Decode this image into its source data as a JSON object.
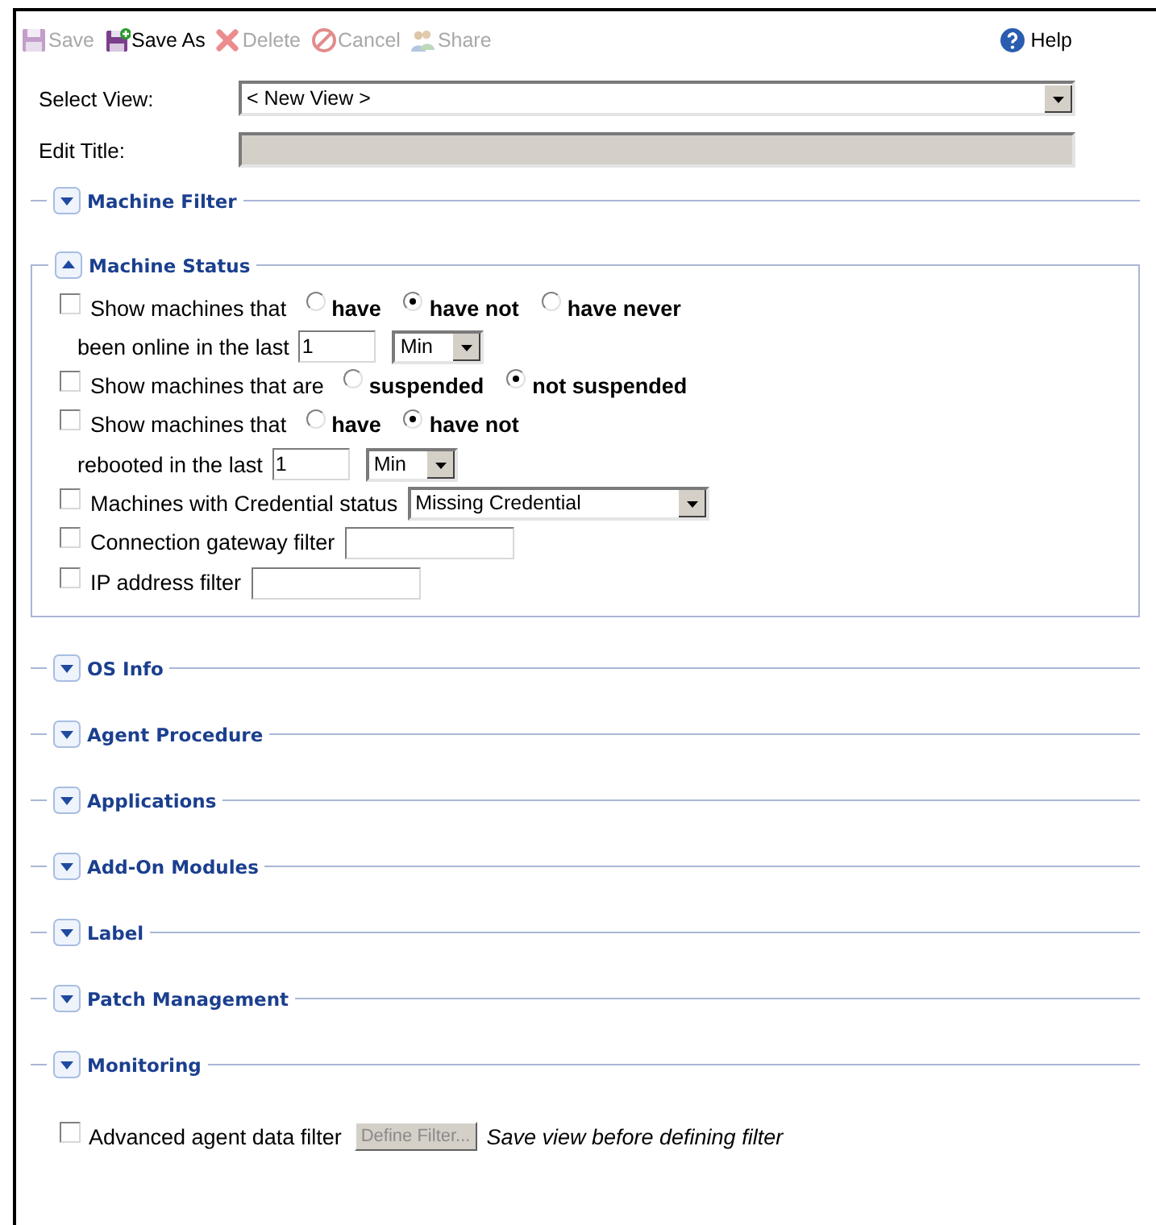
{
  "toolbar": [
    {
      "kind": "save",
      "label": "Save",
      "disabled": true
    },
    {
      "kind": "save_as",
      "label": "Save As",
      "disabled": false
    },
    {
      "kind": "delete",
      "label": "Delete",
      "disabled": true
    },
    {
      "kind": "cancel",
      "label": "Cancel",
      "disabled": true
    },
    {
      "kind": "share",
      "label": "Share",
      "disabled": true
    }
  ],
  "help": {
    "label": "Help"
  },
  "select_view": {
    "label": "Select View:",
    "value": "< New View >"
  },
  "edit_title": {
    "label": "Edit Title:",
    "disabled": true
  },
  "sections": [
    {
      "title": "Machine Filter",
      "expanded": false
    },
    {
      "title": "Machine Status",
      "expanded": true,
      "rows": [
        {
          "kind": "main",
          "items": [
            {
              "kind": "checkbox",
              "checked": false
            },
            {
              "kind": "text",
              "text": "Show machines that"
            },
            {
              "kind": "radio",
              "label": "have",
              "selected": false
            },
            {
              "kind": "radio",
              "label": "have not",
              "selected": true
            },
            {
              "kind": "radio",
              "label": "have never",
              "selected": false
            }
          ]
        },
        {
          "kind": "sub",
          "items": [
            {
              "kind": "text",
              "text": "been online in the last"
            },
            {
              "kind": "input",
              "value": "1"
            },
            {
              "kind": "select",
              "value": "Min"
            }
          ]
        },
        {
          "kind": "main",
          "items": [
            {
              "kind": "checkbox",
              "checked": false
            },
            {
              "kind": "text",
              "text": "Show machines that are"
            },
            {
              "kind": "radio",
              "label": "suspended",
              "selected": false
            },
            {
              "kind": "radio",
              "label": "not suspended",
              "selected": true
            }
          ]
        },
        {
          "kind": "main",
          "items": [
            {
              "kind": "checkbox",
              "checked": false
            },
            {
              "kind": "text",
              "text": "Show machines that"
            },
            {
              "kind": "radio",
              "label": "have",
              "selected": false
            },
            {
              "kind": "radio",
              "label": "have not",
              "selected": true
            }
          ]
        },
        {
          "kind": "sub",
          "items": [
            {
              "kind": "text",
              "text": "rebooted in the last"
            },
            {
              "kind": "input",
              "value": "1"
            },
            {
              "kind": "select",
              "value": "Min"
            }
          ]
        },
        {
          "kind": "main",
          "items": [
            {
              "kind": "checkbox",
              "checked": false
            },
            {
              "kind": "text",
              "text": "Machines with Credential status"
            },
            {
              "kind": "select",
              "value": "Missing Credential",
              "wide": true
            }
          ]
        },
        {
          "kind": "main",
          "items": [
            {
              "kind": "checkbox",
              "checked": false
            },
            {
              "kind": "text",
              "text": "Connection gateway filter"
            },
            {
              "kind": "input",
              "value": ""
            }
          ]
        },
        {
          "kind": "main",
          "items": [
            {
              "kind": "checkbox",
              "checked": false
            },
            {
              "kind": "text",
              "text": "IP address filter"
            },
            {
              "kind": "input",
              "value": ""
            }
          ]
        }
      ]
    },
    {
      "title": "OS Info",
      "expanded": false
    },
    {
      "title": "Agent Procedure",
      "expanded": false
    },
    {
      "title": "Applications",
      "expanded": false
    },
    {
      "title": "Add-On Modules",
      "expanded": false
    },
    {
      "title": "Label",
      "expanded": false
    },
    {
      "title": "Patch Management",
      "expanded": false
    },
    {
      "title": "Monitoring",
      "expanded": false
    }
  ],
  "advanced": {
    "checked": false,
    "label": "Advanced agent data filter",
    "button": "Define Filter...",
    "button_disabled": true,
    "note": "Save view before defining filter"
  }
}
